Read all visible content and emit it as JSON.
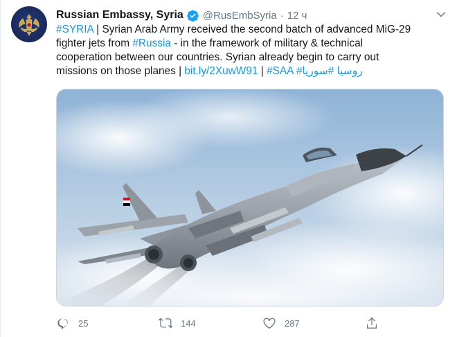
{
  "tweet": {
    "display_name": "Russian Embassy, Syria",
    "handle": "@RusEmbSyria",
    "separator": "·",
    "time": "12 ч",
    "text": {
      "hashtag_syria": "#SYRIA",
      "part1": " | Syrian Arab Army received the second batch of advanced MiG-29",
      "part2": "fighter jets from ",
      "hashtag_russia": "#Russia",
      "part3": " - in the framework of military & technical",
      "line3": "cooperation between our countries. Syrian already begin to carry out",
      "part4": "missions on those planes | ",
      "link": "bit.ly/2XuwW91",
      "part5": " | ",
      "hashtag_saa": "#SAA",
      "part6": " ",
      "hashtag_arabic_russia": "#روسيا",
      "part7": " ",
      "hashtag_arabic_syria": "#سوريا"
    },
    "media": {
      "icon": "mig29-fighter-jet-photo"
    },
    "actions": {
      "replies": "25",
      "retweets": "144",
      "likes": "287"
    }
  },
  "colors": {
    "link": "#1b95e0",
    "verified": "#1da1f2",
    "muted": "#657786"
  }
}
